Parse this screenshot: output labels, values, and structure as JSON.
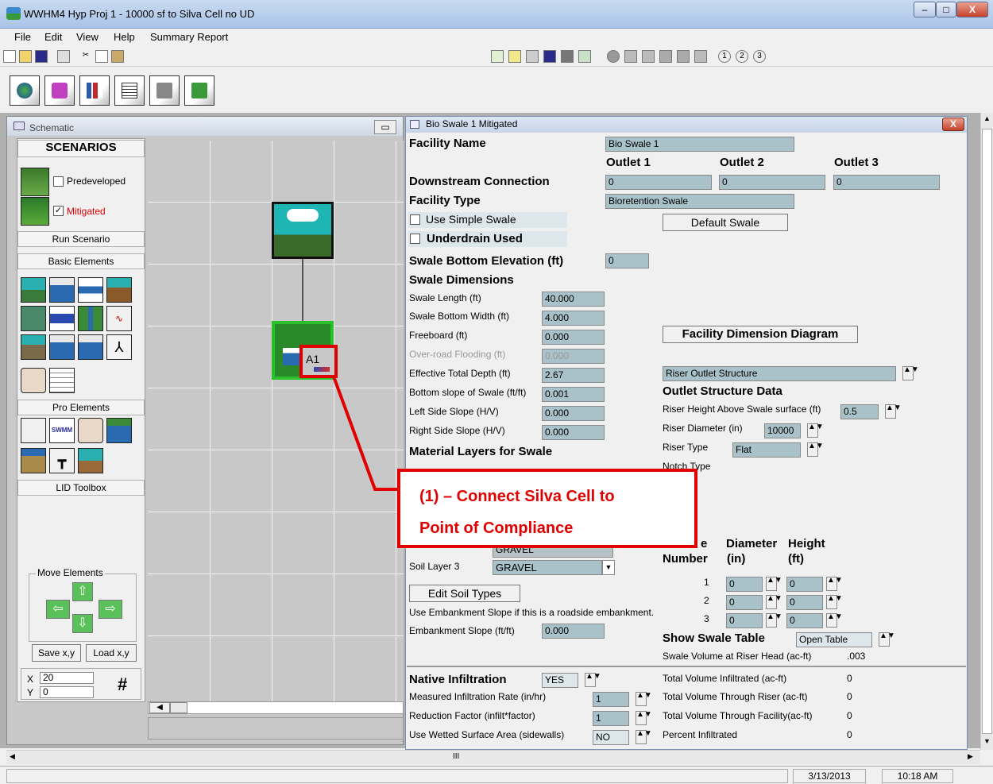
{
  "window": {
    "title": "WWHM4   Hyp Proj 1 - 10000 sf to Silva Cell no UD",
    "min": "–",
    "max": "□",
    "close": "X"
  },
  "menu": [
    "File",
    "Edit",
    "View",
    "Help",
    "Summary Report"
  ],
  "schematic": {
    "title": "Schematic",
    "minimize": "▭",
    "scenarios": "SCENARIOS",
    "predeveloped": "Predeveloped",
    "mitigated": "Mitigated",
    "run": "Run Scenario",
    "basic": "Basic Elements",
    "pro": "Pro Elements",
    "lid": "LID Toolbox",
    "move": "Move Elements",
    "save_xy": "Save x,y",
    "load_xy": "Load x,y",
    "x_label": "X",
    "x_value": "20",
    "y_label": "Y",
    "y_value": "0",
    "hash": "#",
    "node_label": "A1"
  },
  "bio": {
    "title": "Bio Swale 1 Mitigated",
    "close": "X",
    "facility_name_label": "Facility Name",
    "facility_name": "Bio Swale  1",
    "outlet1": "Outlet 1",
    "outlet2": "Outlet 2",
    "outlet3": "Outlet 3",
    "downstream_label": "Downstream Connection",
    "ds1": "0",
    "ds2": "0",
    "ds3": "0",
    "facility_type_label": "Facility Type",
    "facility_type": "Bioretention Swale",
    "use_simple": "Use Simple Swale",
    "underdrain": "Underdrain Used",
    "default_swale": "Default Swale",
    "bottom_elev_label": "Swale Bottom Elevation (ft)",
    "bottom_elev": "0",
    "dims_label": "Swale Dimensions",
    "dims": [
      {
        "label": "Swale Length (ft)",
        "value": "40.000"
      },
      {
        "label": "Swale Bottom Width (ft)",
        "value": "4.000"
      },
      {
        "label": "Freeboard (ft)",
        "value": "0.000"
      },
      {
        "label": "Over-road Flooding (ft)",
        "value": "0.000"
      },
      {
        "label": "Effective Total Depth (ft)",
        "value": "2.67"
      },
      {
        "label": "Bottom slope of Swale (ft/ft)",
        "value": "0.001"
      },
      {
        "label": "Left Side Slope (H/V)",
        "value": "0.000"
      },
      {
        "label": "Right Side Slope (H/V)",
        "value": "0.000"
      }
    ],
    "material_label": "Material Layers for Swale",
    "fdd_button": "Facility Dimension Diagram",
    "outlet_struct": "Riser Outlet Structure",
    "osd_label": "Outlet Structure Data",
    "riser_height_label": "Riser Height Above Swale surface (ft)",
    "riser_height": "0.5",
    "riser_diam_label": "Riser Diameter (in)",
    "riser_diam": "10000",
    "riser_type_label": "Riser Type",
    "riser_type": "Flat",
    "notch_type_label": "Notch Type",
    "soil3_label": "Soil Layer 3",
    "soil3": "GRAVEL",
    "soil2_partial": "GRAVEL",
    "edit_soil": "Edit Soil Types",
    "embank_note": "Use Embankment Slope if this is a roadside embankment.",
    "embank_label": "Embankment Slope (ft/ft)",
    "embank": "0.000",
    "orifice_e": "e",
    "orifice_number": "Number",
    "orifice_diam": "Diameter",
    "orifice_diam_unit": "(in)",
    "orifice_height": "Height",
    "orifice_height_unit": "(ft)",
    "orifices": [
      {
        "n": "1",
        "d": "0",
        "h": "0"
      },
      {
        "n": "2",
        "d": "0",
        "h": "0"
      },
      {
        "n": "3",
        "d": "0",
        "h": "0"
      }
    ],
    "show_table_label": "Show Swale Table",
    "open_table": "Open Table",
    "vol_riser_label": "Swale Volume at Riser Head (ac-ft)",
    "vol_riser": ".003",
    "native_label": "Native Infiltration",
    "native": "YES",
    "mir_label": "Measured Infiltration Rate (in/hr)",
    "mir": "1",
    "rf_label": "Reduction Factor (infilt*factor)",
    "rf": "1",
    "wetted_label": "Use Wetted Surface Area (sidewalls)",
    "wetted": "NO",
    "tvi_label": "Total Volume Infiltrated (ac-ft)",
    "tvi": "0",
    "tvr_label": "Total Volume Through Riser (ac-ft)",
    "tvr": "0",
    "tvf_label": "Total Volume Through Facility(ac-ft)",
    "tvf": "0",
    "pi_label": "Percent Infiltrated",
    "pi": "0"
  },
  "callout": {
    "line1": "(1) – Connect Silva Cell to",
    "line2": "Point of Compliance",
    "color": "#e00000"
  },
  "status": {
    "date": "3/13/2013",
    "time": "10:18 AM",
    "scroll": "III"
  }
}
